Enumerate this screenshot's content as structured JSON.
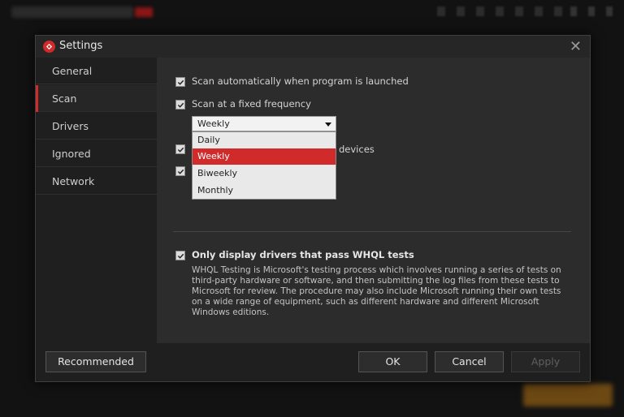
{
  "dialog": {
    "title": "Settings"
  },
  "sidebar": {
    "items": [
      {
        "label": "General"
      },
      {
        "label": "Scan"
      },
      {
        "label": "Drivers"
      },
      {
        "label": "Ignored"
      },
      {
        "label": "Network"
      }
    ],
    "active": "Scan"
  },
  "scan": {
    "auto_scan_label": "Scan automatically when program is launched",
    "auto_scan_checked": true,
    "fixed_freq_label": "Scan at a fixed frequency",
    "fixed_freq_checked": true,
    "frequency_value": "Weekly",
    "frequency_options": [
      "Daily",
      "Weekly",
      "Biweekly",
      "Monthly"
    ],
    "hidden_option_fragment": "devices",
    "whql_label": "Only display drivers that pass WHQL tests",
    "whql_checked": true,
    "whql_desc": "WHQL Testing is Microsoft's testing process which involves running a series of tests on third-party hardware or software, and then submitting the log files from these tests to Microsoft for review. The procedure may also include Microsoft running their own tests on a wide range of equipment, such as different hardware and different Microsoft Windows editions."
  },
  "footer": {
    "recommended_label": "Recommended",
    "ok_label": "OK",
    "cancel_label": "Cancel",
    "apply_label": "Apply"
  },
  "colors": {
    "accent": "#d12a2a",
    "dialog_bg": "#2c2c2c",
    "sidebar_bg": "#1f1f1f"
  }
}
